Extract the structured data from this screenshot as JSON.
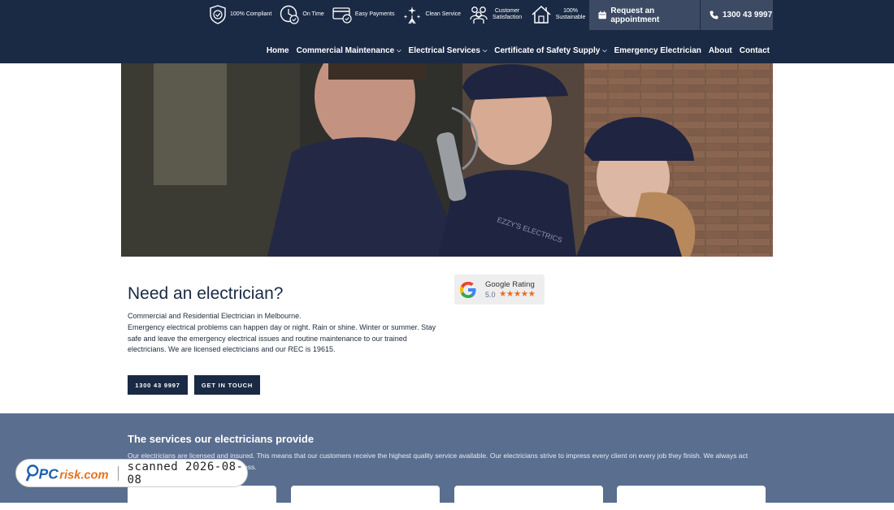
{
  "header": {
    "badges": [
      {
        "label": "100% Compliant",
        "icon": "shield-check-icon"
      },
      {
        "label": "On Time",
        "icon": "clock-check-icon"
      },
      {
        "label": "Easy Payments",
        "icon": "card-check-icon"
      },
      {
        "label": "Clean Service",
        "icon": "sparkle-broom-icon"
      },
      {
        "label": "Customer Satisfaction",
        "icon": "people-icon"
      },
      {
        "label": "100% Sustainable",
        "icon": "eco-house-icon"
      }
    ],
    "appointment_label": "Request an appointment",
    "phone_label": "1300 43 9997"
  },
  "nav": {
    "items": [
      {
        "label": "Home",
        "dropdown": false
      },
      {
        "label": "Commercial Maintenance",
        "dropdown": true
      },
      {
        "label": "Electrical Services",
        "dropdown": true
      },
      {
        "label": "Certificate of Safety Supply",
        "dropdown": true
      },
      {
        "label": "Emergency Electrician",
        "dropdown": false
      },
      {
        "label": "About",
        "dropdown": false
      },
      {
        "label": "Contact",
        "dropdown": false
      }
    ]
  },
  "intro": {
    "heading": "Need an electrician?",
    "line1": "Commercial and Residential Electrician in Melbourne.",
    "line2": "Emergency electrical problems can happen day or night. Rain or shine. Winter or summer. Stay safe and leave the emergency electrical issues and routine maintenance to our trained electricians. We are licensed electricians and our REC is 19615.",
    "phone_button": "1300 43 9997",
    "contact_button": "GET IN TOUCH"
  },
  "google_rating": {
    "title": "Google Rating",
    "score": "5.0",
    "stars": "★★★★★",
    "rating": 5,
    "max": 5
  },
  "services": {
    "heading": "The services our electricians provide",
    "text": "Our electricians are licensed and insured. This means that our customers receive the highest quality service available. Our electricians strive to impress every client on every job they finish. We always act                                    e a reputation for cleanliness and tidiness."
  },
  "watermark": {
    "text": "scanned 2026-08-08"
  },
  "colors": {
    "navy": "#1a2a45",
    "slate": "#5a6e8f",
    "star": "#ef6b1c"
  }
}
